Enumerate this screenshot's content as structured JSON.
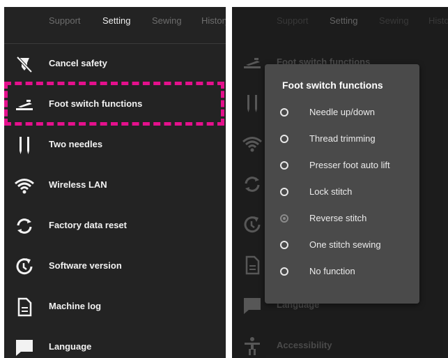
{
  "left_panel": {
    "tabs": [
      "Support",
      "Setting",
      "Sewing",
      "History"
    ],
    "active_tab": "Setting",
    "items": [
      {
        "label": "Cancel safety",
        "icon": "safety-cancel-icon"
      },
      {
        "label": "Foot switch functions",
        "icon": "foot-switch-icon"
      },
      {
        "label": "Two needles",
        "icon": "two-needles-icon"
      },
      {
        "label": "Wireless LAN",
        "icon": "wifi-icon"
      },
      {
        "label": "Factory data reset",
        "icon": "reset-icon"
      },
      {
        "label": "Software version",
        "icon": "software-version-icon"
      },
      {
        "label": "Machine log",
        "icon": "machine-log-icon"
      },
      {
        "label": "Language",
        "icon": "language-icon"
      }
    ],
    "highlighted_item": "Foot switch functions",
    "highlight_color": "#e4108c"
  },
  "right_panel": {
    "tabs": [
      "Support",
      "Setting",
      "Sewing",
      "History"
    ],
    "active_tab": "Setting",
    "items": [
      {
        "label": "Foot switch functions",
        "icon": "foot-switch-icon"
      },
      {
        "label": "",
        "icon": "two-needles-icon"
      },
      {
        "label": "",
        "icon": "wifi-icon"
      },
      {
        "label": "",
        "icon": "reset-icon"
      },
      {
        "label": "",
        "icon": "software-version-icon"
      },
      {
        "label": "",
        "icon": "machine-log-icon"
      },
      {
        "label": "Language",
        "icon": "language-icon"
      },
      {
        "label": "Accessibility",
        "icon": "accessibility-icon"
      }
    ],
    "dialog": {
      "title": "Foot switch functions",
      "options": [
        {
          "label": "Needle up/down",
          "selected": false
        },
        {
          "label": "Thread trimming",
          "selected": false
        },
        {
          "label": "Presser foot auto lift",
          "selected": false
        },
        {
          "label": "Lock stitch",
          "selected": false
        },
        {
          "label": "Reverse stitch",
          "selected": true
        },
        {
          "label": "One stitch sewing",
          "selected": false
        },
        {
          "label": "No function",
          "selected": false
        }
      ]
    }
  }
}
